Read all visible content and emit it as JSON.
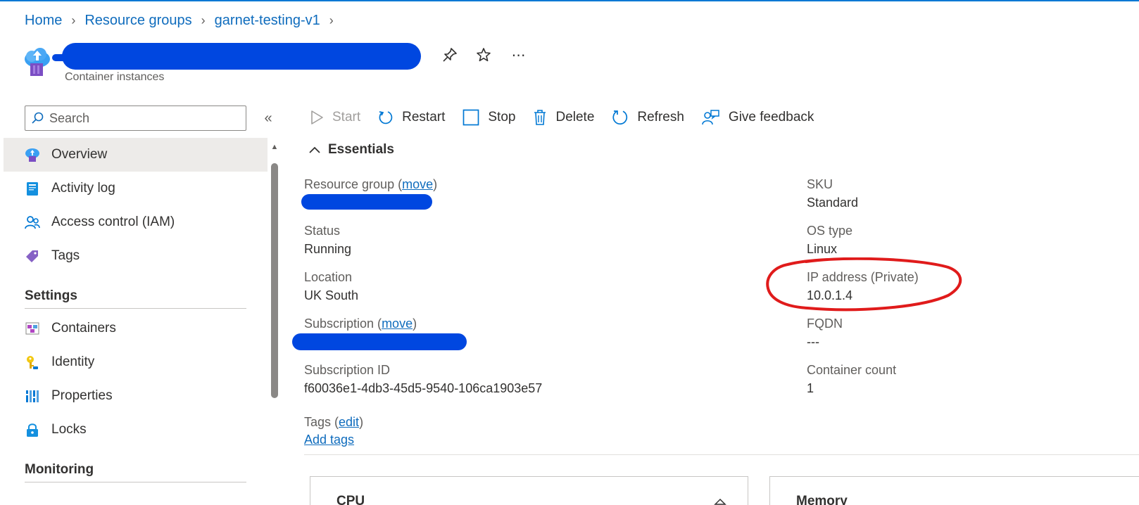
{
  "breadcrumb": {
    "items": [
      "Home",
      "Resource groups",
      "garnet-testing-v1"
    ]
  },
  "header": {
    "subtitle": "Container instances",
    "actions": [
      "pin-icon",
      "star-icon",
      "more-icon"
    ]
  },
  "sidebar": {
    "search_placeholder": "Search",
    "items": [
      {
        "label": "Overview",
        "icon": "overview-icon",
        "active": true
      },
      {
        "label": "Activity log",
        "icon": "activity-log-icon"
      },
      {
        "label": "Access control (IAM)",
        "icon": "iam-icon"
      },
      {
        "label": "Tags",
        "icon": "tag-icon"
      }
    ],
    "settings_heading": "Settings",
    "settings_items": [
      {
        "label": "Containers",
        "icon": "containers-icon"
      },
      {
        "label": "Identity",
        "icon": "key-icon"
      },
      {
        "label": "Properties",
        "icon": "properties-icon"
      },
      {
        "label": "Locks",
        "icon": "lock-icon"
      }
    ],
    "monitoring_heading": "Monitoring"
  },
  "toolbar": {
    "start": "Start",
    "restart": "Restart",
    "stop": "Stop",
    "delete": "Delete",
    "refresh": "Refresh",
    "feedback": "Give feedback"
  },
  "essentials": {
    "heading": "Essentials",
    "resource_group_label": "Resource group (",
    "resource_group_link": "move",
    "status_label": "Status",
    "status_value": "Running",
    "location_label": "Location",
    "location_value": "UK South",
    "subscription_label": "Subscription (",
    "subscription_link": "move",
    "subscription_id_label": "Subscription ID",
    "subscription_id_value": "f60036e1-4db3-45d5-9540-106ca1903e57",
    "tags_label": "Tags (",
    "tags_link": "edit",
    "add_tags": "Add tags",
    "sku_label": "SKU",
    "sku_value": "Standard",
    "os_label": "OS type",
    "os_value": "Linux",
    "ip_label": "IP address (Private)",
    "ip_value": "10.0.1.4",
    "fqdn_label": "FQDN",
    "fqdn_value": "---",
    "count_label": "Container count",
    "count_value": "1"
  },
  "cards": {
    "cpu": "CPU",
    "memory": "Memory"
  },
  "colors": {
    "accent": "#0078d4",
    "link": "#0f6cbd",
    "redaction": "#0047e0",
    "annotation": "#e01b1b"
  }
}
